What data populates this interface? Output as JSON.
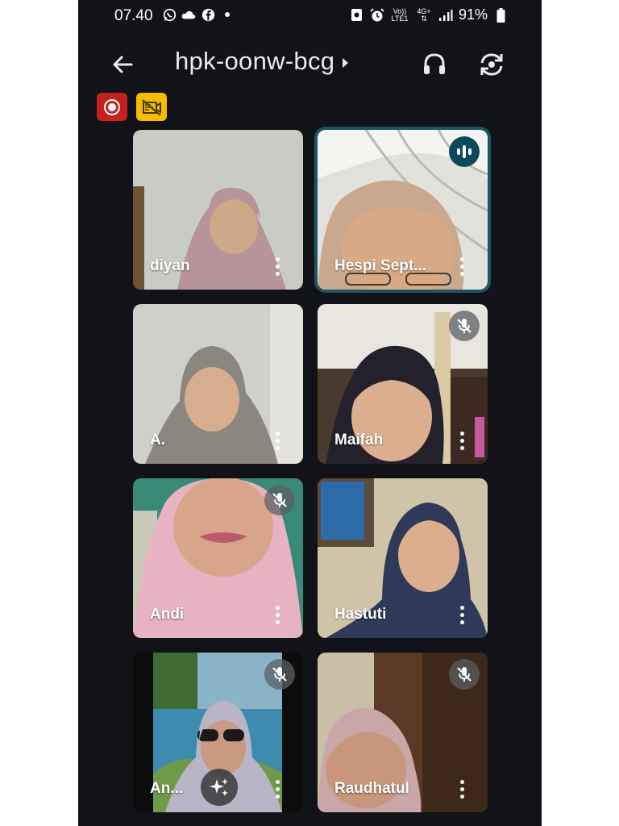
{
  "status_bar": {
    "time": "07.40",
    "left_icons": [
      "whatsapp-icon",
      "cloud-icon",
      "facebook-icon",
      "dot-icon"
    ],
    "network_label_top": "Vo)) LTE1",
    "network_label_4g": "4G+",
    "battery": "91%"
  },
  "meeting": {
    "code": "hpk-oonw-bcg"
  },
  "participants": [
    {
      "name": "diyan",
      "muted": false,
      "speaking": false
    },
    {
      "name": "Hespi Sept...",
      "muted": false,
      "speaking": true
    },
    {
      "name": "A.",
      "muted": false,
      "speaking": false
    },
    {
      "name": "Maifah",
      "muted": true,
      "speaking": false
    },
    {
      "name": "Andi",
      "muted": true,
      "speaking": false
    },
    {
      "name": "Hastuti",
      "muted": false,
      "speaking": false
    },
    {
      "name": "An...",
      "muted": true,
      "speaking": false
    },
    {
      "name": "Raudhatul",
      "muted": true,
      "speaking": false
    }
  ],
  "colors": {
    "background": "#111318",
    "recording": "#c5221f",
    "no_capture": "#f9bb00",
    "speaking_outline": "#1a5566"
  }
}
